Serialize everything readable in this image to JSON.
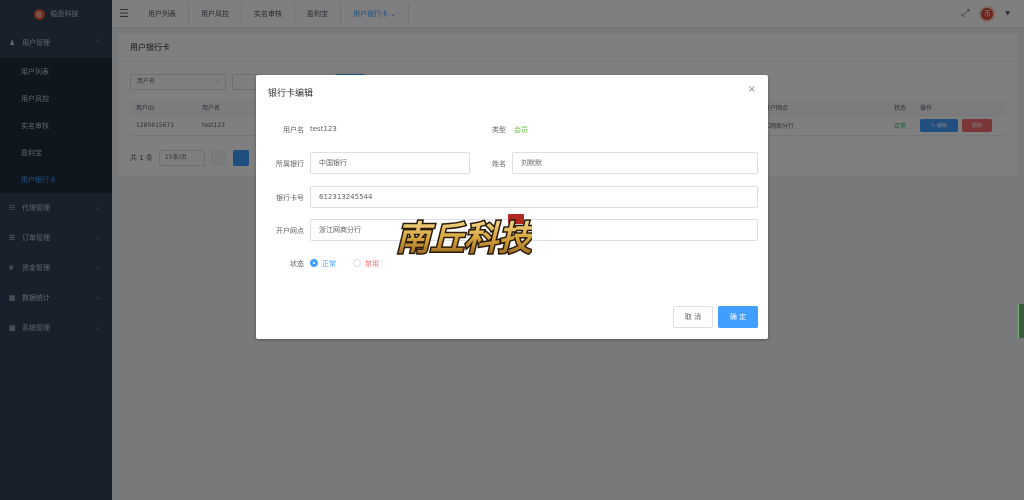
{
  "app": {
    "name": "稳盈科技",
    "logo_char": "稳"
  },
  "sidebar": {
    "groups": [
      {
        "label": "用户管理",
        "icon": "user-icon",
        "expanded": true,
        "items": [
          {
            "label": "用户列表"
          },
          {
            "label": "用户风控"
          },
          {
            "label": "实名审核"
          },
          {
            "label": "盈利宝"
          },
          {
            "label": "用户银行卡",
            "active": true
          }
        ]
      },
      {
        "label": "代理管理",
        "icon": "agent-icon"
      },
      {
        "label": "订单管理",
        "icon": "order-icon"
      },
      {
        "label": "资金管理",
        "icon": "money-icon"
      },
      {
        "label": "数据统计",
        "icon": "chart-icon"
      },
      {
        "label": "系统管理",
        "icon": "system-icon"
      }
    ]
  },
  "topbar": {
    "tabs": [
      {
        "label": "用户列表"
      },
      {
        "label": "用户风控"
      },
      {
        "label": "实名审核"
      },
      {
        "label": "盈利宝"
      },
      {
        "label": "用户银行卡",
        "active": true,
        "closable": true
      }
    ],
    "avatar_char": "币"
  },
  "page": {
    "title": "用户银行卡",
    "search": {
      "field_selected": "用户名"
    },
    "table": {
      "headers": [
        "用户ID",
        "用户名",
        "开户网点",
        "状态",
        "操作"
      ],
      "rows": [
        {
          "id": "1285615671",
          "username": "test123",
          "branch": "江网商分行",
          "status": "正常",
          "edit": "✎ 编辑",
          "delete": "删除"
        }
      ]
    },
    "pager": {
      "total": "共 1 条",
      "page_size": "15条/页"
    }
  },
  "dialog": {
    "title": "银行卡编辑",
    "fields": {
      "username": {
        "label": "用户名",
        "value": "test123"
      },
      "type": {
        "label": "类型",
        "value": "会员"
      },
      "bank": {
        "label": "所属银行",
        "value": "中国银行"
      },
      "name": {
        "label": "姓名",
        "value": "刘默默"
      },
      "card_no": {
        "label": "银行卡号",
        "value": "612313245544"
      },
      "branch": {
        "label": "开户网点",
        "value": "浙江网商分行"
      }
    },
    "status": {
      "label": "状态",
      "options": [
        {
          "label": "正常",
          "checked": true,
          "color": "#409eff"
        },
        {
          "label": "禁用",
          "checked": false,
          "color": "#f56c6c"
        }
      ]
    },
    "buttons": {
      "cancel": "取 消",
      "confirm": "确 定"
    }
  },
  "watermark": {
    "text": "南丘科技"
  },
  "colors": {
    "primary": "#409eff",
    "sidebar_bg": "#304156",
    "danger": "#f56c6c",
    "success": "#67c23a"
  }
}
